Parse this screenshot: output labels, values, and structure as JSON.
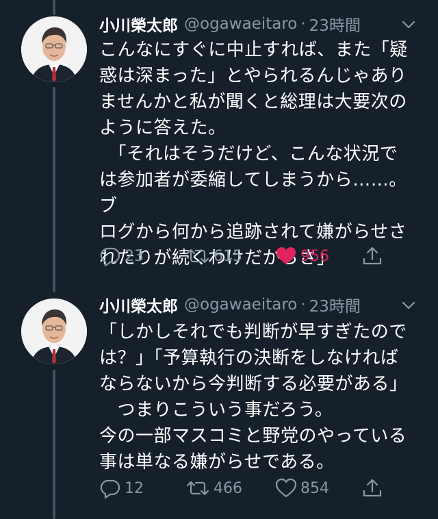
{
  "tweets": [
    {
      "name": "小川榮太郎",
      "handle": "@ogawaeitaro",
      "separator": "·",
      "time": "23時間",
      "body": "こんなにすぐに中止すれば、また「疑\n惑は深まった」とやられるんじゃあり\nませんかと私が聞くと総理は大要次の\nように答えた。\n　「それはそうだけど、こんな状況で\nは参加者が委縮してしまうから……。ブ\nログから何から追跡されて嫌がらせさ\nれたりが続くわけだからさ」",
      "replies": "23",
      "retweets": "615",
      "likes": "956",
      "liked": true
    },
    {
      "name": "小川榮太郎",
      "handle": "@ogawaeitaro",
      "separator": "·",
      "time": "23時間",
      "body": "「しかしそれでも判断が早すぎたので\nは？」「予算執行の決断をしなければ\nならないから今判断する必要がある」\n　つまりこういう事だろう。\n今の一部マスコミと野党のやっている\n事は単なる嫌がらせである。",
      "replies": "12",
      "retweets": "466",
      "likes": "854",
      "liked": false
    }
  ],
  "icons": {
    "reply": "reply-icon",
    "retweet": "retweet-icon",
    "like": "heart-icon",
    "share": "share-icon",
    "caret": "chevron-down-icon"
  },
  "colors": {
    "background": "#15202b",
    "secondary_text": "#8899a6",
    "like_active": "#e0245e",
    "thread_line": "#3d5466"
  }
}
